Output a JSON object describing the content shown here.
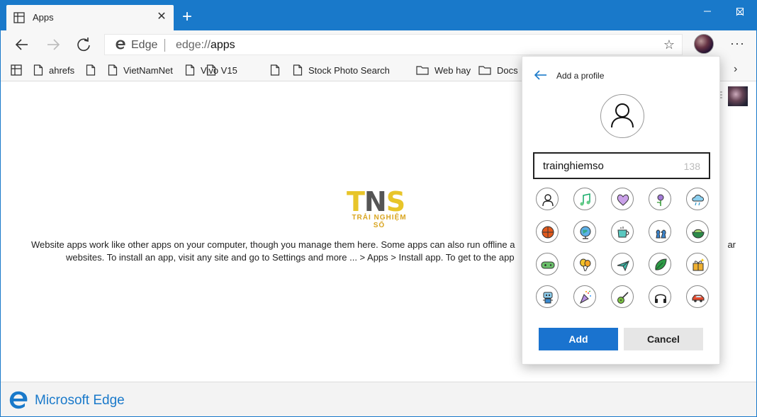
{
  "tab": {
    "title": "Apps",
    "close": "✕"
  },
  "window_controls": {
    "minimize": "—",
    "maximize": "☐",
    "close": "✕"
  },
  "address_bar": {
    "site_name": "Edge",
    "url_scheme": "edge://",
    "url_path": "apps",
    "favorite": "☆"
  },
  "menu": {
    "more": "···"
  },
  "favorites": [
    {
      "label": "ahrefs",
      "icon": "page-icon"
    },
    {
      "label": "",
      "icon": "page-icon"
    },
    {
      "label": "VietNamNet",
      "icon": "page-icon"
    },
    {
      "label": "Vivo V15",
      "icon": "page-icon"
    },
    {
      "label": "",
      "icon": "page-icon"
    },
    {
      "label": "",
      "icon": "page-icon"
    },
    {
      "label": "Stock Photo Search",
      "icon": "page-icon"
    },
    {
      "label": "Web hay",
      "icon": "folder-icon"
    },
    {
      "label": "Docs",
      "icon": "folder-icon"
    }
  ],
  "favorites_more": "›",
  "page": {
    "logo_letters": "TNS",
    "logo_tagline": "TRẢI NGHIỆM SỐ",
    "description_line1": "Website apps work like other apps on your computer, though you manage them here. Some apps can also run offline a",
    "description_line1_tail": "ar",
    "description_line2": "websites. To install an app, visit any site and go to Settings and more ... > Apps > Install app. To get to the app"
  },
  "footer": {
    "brand": "Microsoft Edge"
  },
  "flyout": {
    "title": "Add a profile",
    "name_value": "trainghiemso",
    "char_count": "138",
    "add_label": "Add",
    "cancel_label": "Cancel",
    "pictures": [
      "person-icon",
      "music-note-icon",
      "heart-icon",
      "flower-icon",
      "rain-cloud-icon",
      "basketball-icon",
      "globe-icon",
      "coffee-cup-icon",
      "chess-icon",
      "bowl-icon",
      "game-controller-icon",
      "balloons-icon",
      "airplane-icon",
      "leaf-icon",
      "gift-icon",
      "robot-icon",
      "party-popper-icon",
      "guitar-icon",
      "headphones-icon",
      "car-icon"
    ]
  }
}
